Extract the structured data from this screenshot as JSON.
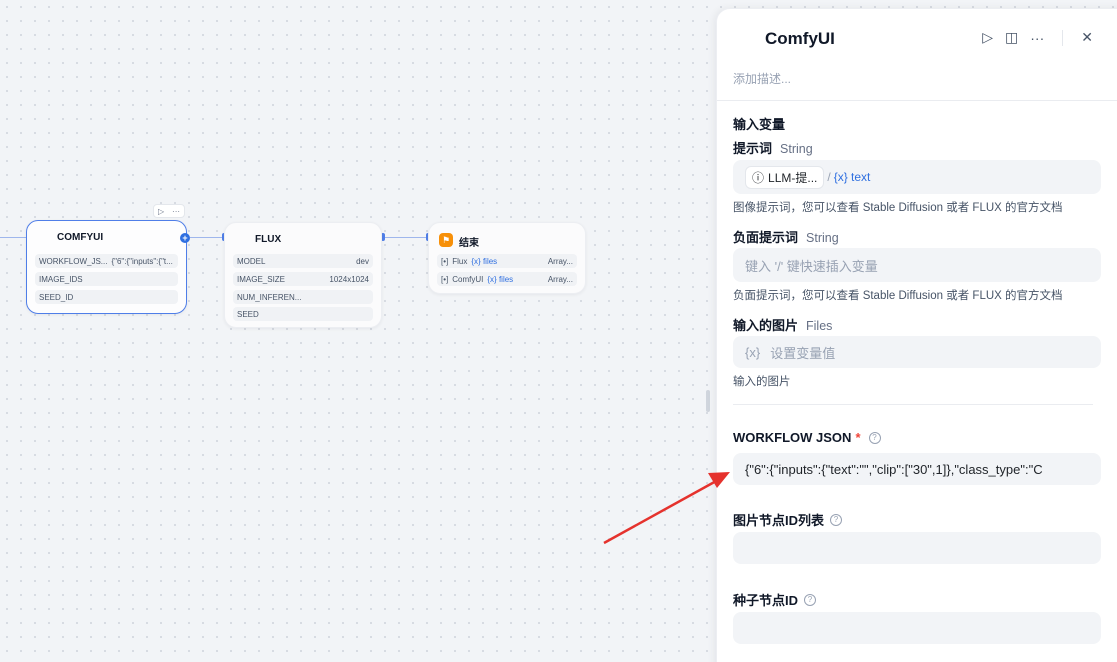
{
  "canvas": {
    "comfy_node": {
      "title": "COMFYUI",
      "rows": [
        {
          "label": "WORKFLOW_JS...",
          "value": "{\"6\":{\"inputs\":{\"t..."
        },
        {
          "label": "IMAGE_IDS",
          "value": ""
        },
        {
          "label": "SEED_ID",
          "value": ""
        }
      ],
      "toolbar_run": "▷",
      "toolbar_more": "···"
    },
    "flux_node": {
      "title": "FLUX",
      "rows": [
        {
          "label": "MODEL",
          "value": "dev"
        },
        {
          "label": "IMAGE_SIZE",
          "value": "1024x1024"
        },
        {
          "label": "NUM_INFEREN...",
          "value": ""
        },
        {
          "label": "SEED",
          "value": ""
        }
      ]
    },
    "end_node": {
      "title": "结束",
      "rows": [
        {
          "label": "Flux",
          "var": "{x} files",
          "value": "Array..."
        },
        {
          "label": "ComfyUI",
          "var": "{x} files",
          "value": "Array..."
        }
      ]
    }
  },
  "panel": {
    "title": "ComfyUI",
    "description_placeholder": "添加描述...",
    "section_title": "输入变量",
    "prompt": {
      "label": "提示词",
      "type": "String",
      "chip_source": "LLM-提...",
      "chip_var": "{x} text",
      "hint": "图像提示词，您可以查看 Stable Diffusion 或者 FLUX 的官方文档"
    },
    "negative_prompt": {
      "label": "负面提示词",
      "type": "String",
      "placeholder": "键入 '/' 键快速插入变量",
      "hint": "负面提示词，您可以查看 Stable Diffusion 或者 FLUX 的官方文档"
    },
    "input_image": {
      "label": "输入的图片",
      "type": "Files",
      "placeholder": "设置变量值",
      "placeholder_icon": "{x}",
      "hint": "输入的图片"
    },
    "workflow_json": {
      "label": "WORKFLOW JSON",
      "required_mark": "*",
      "value": "{\"6\":{\"inputs\":{\"text\":\"\",\"clip\":[\"30\",1]},\"class_type\":\"C"
    },
    "image_node_ids": {
      "label": "图片节点ID列表",
      "value": ""
    },
    "seed_node_id": {
      "label": "种子节点ID",
      "value": ""
    }
  },
  "colors": {
    "accent": "#2f6fe0",
    "arrow": "#e5322d",
    "end_icon": "#f79009"
  }
}
